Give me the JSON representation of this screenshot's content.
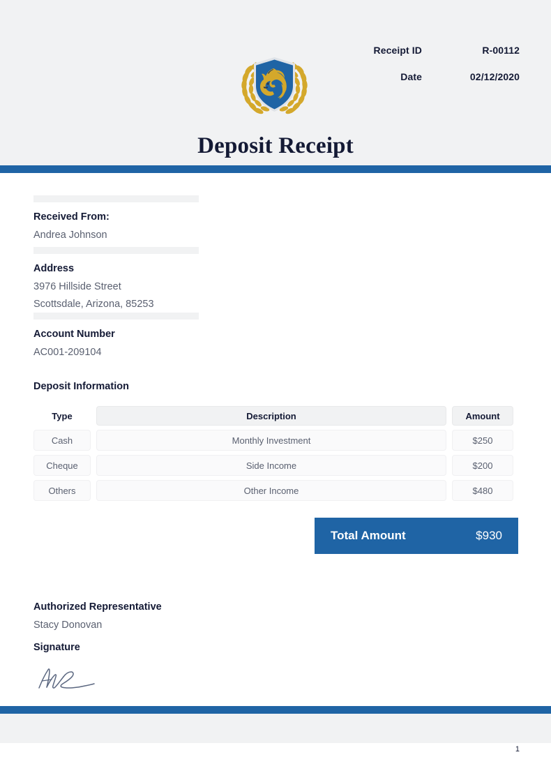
{
  "document": {
    "title": "Deposit Receipt",
    "page_number": "1"
  },
  "brand": {
    "logo_icon": "shield-lion-laurel-logo",
    "accent_blue": "#1f64a5",
    "shield_blue": "#1f64a5",
    "laurel_gold": "#d4a82b",
    "band_gray": "#f1f2f3",
    "label_navy": "#141a35",
    "value_gray": "#5a6070"
  },
  "header": {
    "receipt_id_label": "Receipt ID",
    "receipt_id_value": "R-00112",
    "date_label": "Date",
    "date_value": "02/12/2020"
  },
  "payer": {
    "received_from_label": "Received From:",
    "received_from_value": "Andrea Johnson",
    "address_label": "Address",
    "address_line1": "3976 Hillside Street",
    "address_line2": "Scottsdale, Arizona, 85253",
    "account_label": "Account Number",
    "account_value": "AC001-209104"
  },
  "deposit": {
    "section_title": "Deposit Information",
    "columns": {
      "type": "Type",
      "description": "Description",
      "amount": "Amount"
    },
    "rows": [
      {
        "type": "Cash",
        "description": "Monthly Investment",
        "amount": "$250"
      },
      {
        "type": "Cheque",
        "description": "Side Income",
        "amount": "$200"
      },
      {
        "type": "Others",
        "description": "Other Income",
        "amount": "$480"
      }
    ],
    "total_label": "Total Amount",
    "total_value": "$930"
  },
  "authorization": {
    "representative_label": "Authorized Representative",
    "representative_name": "Stacy Donovan",
    "signature_label": "Signature",
    "signature_icon": "handwritten-signature"
  }
}
